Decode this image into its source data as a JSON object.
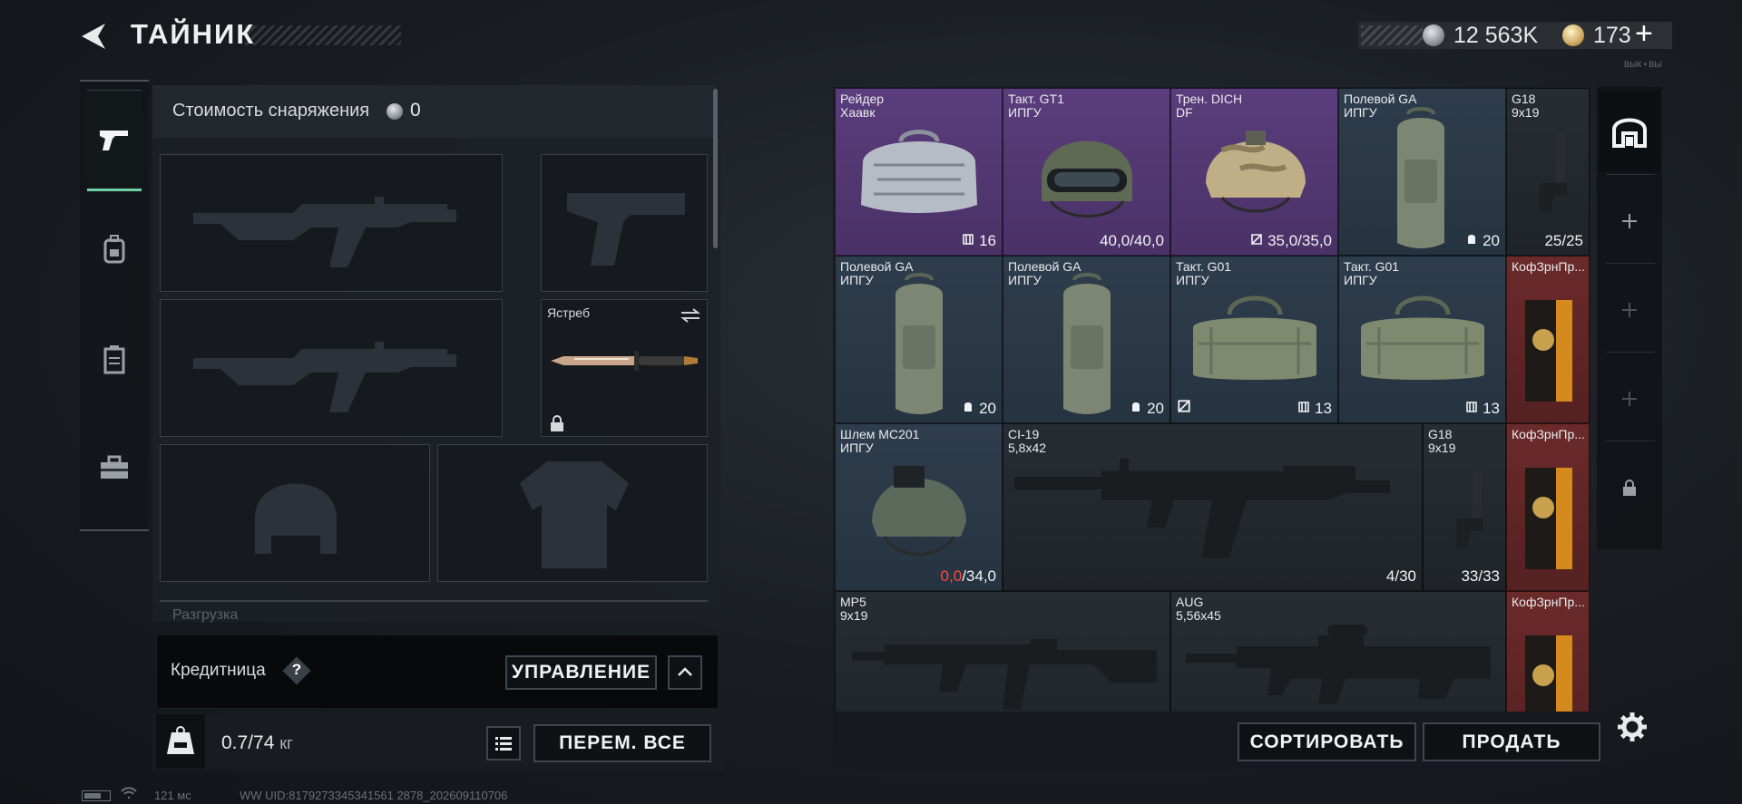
{
  "header": {
    "title": "ТАЙНИК",
    "currency_silver": "12 563K",
    "currency_gold": "173",
    "add_label": "+",
    "corner_note": "ВЫК • ВЫ"
  },
  "equipment": {
    "value_label": "Стоимость снаряжения",
    "value_amount": "0",
    "secondary_name": "Ястреб",
    "next_section_label": "Разгрузка"
  },
  "wallet": {
    "label": "Кредитница",
    "help": "?",
    "manage_label": "УПРАВЛЕНИЕ"
  },
  "bottom": {
    "weight_value": "0.7/74",
    "weight_unit": "кг",
    "move_all_label": "ПЕРЕМ. ВСЕ",
    "sort_label": "СОРТИРОВАТЬ",
    "sell_label": "ПРОДАТЬ"
  },
  "stash": {
    "items": [
      {
        "name1": "Рейдер",
        "name2": "Хаавк",
        "stat": "16",
        "stat_icon": "capacity-icon",
        "rarity": "purple"
      },
      {
        "name1": "Такт. GT1",
        "name2": "ИПГУ",
        "stat": "40,0/40,0",
        "stat_icon": "",
        "rarity": "purple"
      },
      {
        "name1": "Трен. DICH",
        "name2": "DF",
        "stat": "35,0/35,0",
        "stat_icon": "durability-icon",
        "rarity": "purple"
      },
      {
        "name1": "Полевой GA",
        "name2": "ИПГУ",
        "stat": "20",
        "stat_icon": "capacity-icon",
        "rarity": "blue"
      },
      {
        "name1": "G18",
        "name2": "9x19",
        "stat": "25/25",
        "stat_icon": "",
        "rarity": "dark"
      },
      {
        "name1": "Полевой GA",
        "name2": "ИПГУ",
        "stat": "20",
        "stat_icon": "capacity-icon",
        "rarity": "blue"
      },
      {
        "name1": "Полевой GA",
        "name2": "ИПГУ",
        "stat": "20",
        "stat_icon": "capacity-icon",
        "rarity": "blue"
      },
      {
        "name1": "Такт. G01",
        "name2": "ИПГУ",
        "stat": "13",
        "stat_icon": "capacity-icon",
        "rarity": "blue"
      },
      {
        "name1": "Такт. G01",
        "name2": "ИПГУ",
        "stat": "13",
        "stat_icon": "capacity-icon",
        "rarity": "blue"
      },
      {
        "name1": "КофЗрнПр...",
        "name2": "",
        "stat": "",
        "stat_icon": "",
        "rarity": "red"
      },
      {
        "name1": "Шлем MC201",
        "name2": "ИПГУ",
        "stat_red": "0,0",
        "stat": "/34,0",
        "stat_icon": "",
        "rarity": "blue"
      },
      {
        "name1": "CI-19",
        "name2": "5,8x42",
        "stat": "4/30",
        "stat_icon": "",
        "rarity": "dark"
      },
      {
        "name1": "G18",
        "name2": "9x19",
        "stat": "33/33",
        "stat_icon": "",
        "rarity": "dark"
      },
      {
        "name1": "КофЗрнПр...",
        "name2": "",
        "stat": "",
        "stat_icon": "",
        "rarity": "red"
      },
      {
        "name1": "MP5",
        "name2": "9x19",
        "stat": "",
        "stat_icon": "",
        "rarity": "dark"
      },
      {
        "name1": "AUG",
        "name2": "5,56x45",
        "stat": "",
        "stat_icon": "",
        "rarity": "dark"
      },
      {
        "name1": "КофЗрнПр...",
        "name2": "",
        "stat": "",
        "stat_icon": "",
        "rarity": "red"
      }
    ]
  },
  "status_bar": {
    "ping": "121 мс",
    "uid": "WW UID:8179273345341561 2878_202609110706"
  },
  "colors": {
    "accent_green": "#6fd1a6",
    "rarity_purple": "#5a3d7d",
    "rarity_blue": "#2e3d4d",
    "rarity_red": "#6b2a2a",
    "durability_low": "#ff4a3f"
  }
}
